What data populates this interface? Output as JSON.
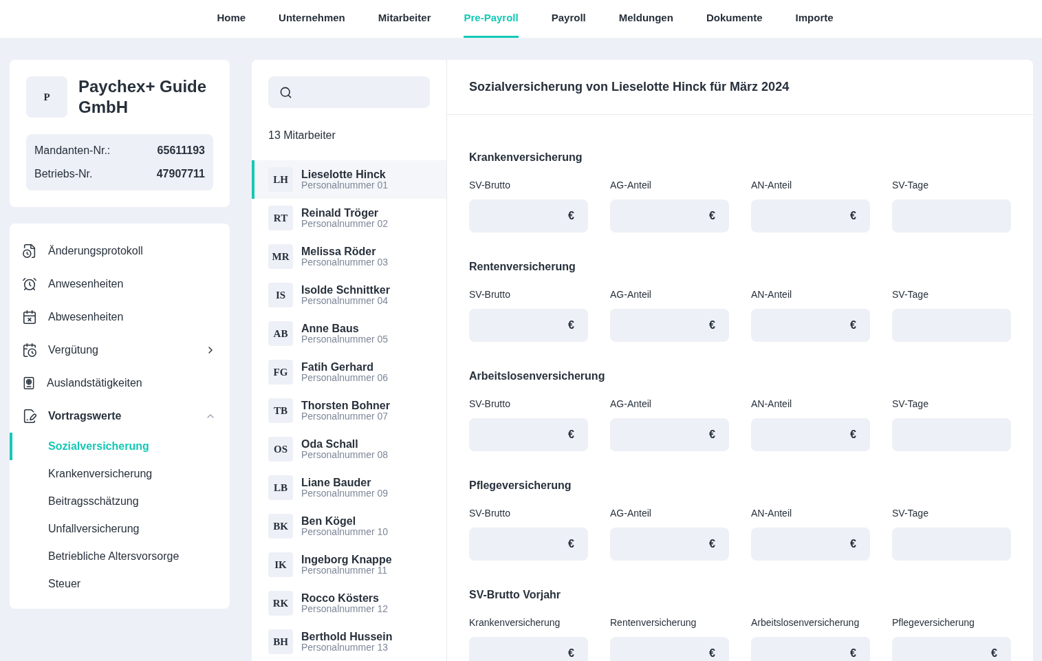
{
  "nav": [
    {
      "label": "Home",
      "selected": false
    },
    {
      "label": "Unternehmen",
      "selected": false
    },
    {
      "label": "Mitarbeiter",
      "selected": false
    },
    {
      "label": "Pre-Payroll",
      "selected": true
    },
    {
      "label": "Payroll",
      "selected": false
    },
    {
      "label": "Meldungen",
      "selected": false
    },
    {
      "label": "Dokumente",
      "selected": false
    },
    {
      "label": "Importe",
      "selected": false
    }
  ],
  "company": {
    "initial": "P",
    "name": "Paychex+ Guide GmbH",
    "facts": [
      {
        "label": "Mandanten-Nr.:",
        "value": "65611193"
      },
      {
        "label": "Betriebs-Nr.",
        "value": "47907711"
      }
    ]
  },
  "sidebar": {
    "items": [
      {
        "kind": "link",
        "label": "Änderungsprotokoll"
      },
      {
        "kind": "link",
        "label": "Anwesenheiten"
      },
      {
        "kind": "link",
        "label": "Abwesenheiten"
      },
      {
        "kind": "group",
        "label": "Vergütung",
        "expanded": false
      },
      {
        "kind": "link",
        "label": "Auslandstätigkeiten"
      },
      {
        "kind": "group",
        "label": "Vortragswerte",
        "expanded": true,
        "children": [
          {
            "label": "Sozialversicherung",
            "selected": true
          },
          {
            "label": "Krankenversicherung",
            "selected": false
          },
          {
            "label": "Beitragsschätzung",
            "selected": false
          },
          {
            "label": "Unfallversicherung",
            "selected": false
          },
          {
            "label": "Betriebliche Altersvorsorge",
            "selected": false
          },
          {
            "label": "Steuer",
            "selected": false
          }
        ]
      }
    ]
  },
  "employees": {
    "count": "13 Mitarbeiter",
    "rows": [
      {
        "initials": "LH",
        "name": "Lieselotte Hinck",
        "number": "Personalnummer 01",
        "selected": true
      },
      {
        "initials": "RT",
        "name": "Reinald Tröger",
        "number": "Personalnummer 02",
        "selected": false
      },
      {
        "initials": "MR",
        "name": "Melissa Röder",
        "number": "Personalnummer 03",
        "selected": false
      },
      {
        "initials": "IS",
        "name": "Isolde Schnittker",
        "number": "Personalnummer 04",
        "selected": false
      },
      {
        "initials": "AB",
        "name": "Anne Baus",
        "number": "Personalnummer 05",
        "selected": false
      },
      {
        "initials": "FG",
        "name": "Fatih Gerhard",
        "number": "Personalnummer 06",
        "selected": false
      },
      {
        "initials": "TB",
        "name": "Thorsten Bohner",
        "number": "Personalnummer 07",
        "selected": false
      },
      {
        "initials": "OS",
        "name": "Oda Schall",
        "number": "Personalnummer 08",
        "selected": false
      },
      {
        "initials": "LB",
        "name": "Liane Bauder",
        "number": "Personalnummer 09",
        "selected": false
      },
      {
        "initials": "BK",
        "name": "Ben Kögel",
        "number": "Personalnummer 10",
        "selected": false
      },
      {
        "initials": "IK",
        "name": "Ingeborg Knappe",
        "number": "Personalnummer 11",
        "selected": false
      },
      {
        "initials": "RK",
        "name": "Rocco Kösters",
        "number": "Personalnummer 12",
        "selected": false
      },
      {
        "initials": "BH",
        "name": "Berthold Hussein",
        "number": "Personalnummer 13",
        "selected": false
      }
    ]
  },
  "detail": {
    "title": "Sozialversicherung von Lieselotte Hinck für März 2024",
    "sections": [
      {
        "title": "Krankenversicherung",
        "fields": [
          {
            "label": "SV-Brutto",
            "unit": "€"
          },
          {
            "label": "AG-Anteil",
            "unit": "€"
          },
          {
            "label": "AN-Anteil",
            "unit": "€"
          },
          {
            "label": "SV-Tage"
          }
        ]
      },
      {
        "title": "Rentenversicherung",
        "fields": [
          {
            "label": "SV-Brutto",
            "unit": "€"
          },
          {
            "label": "AG-Anteil",
            "unit": "€"
          },
          {
            "label": "AN-Anteil",
            "unit": "€"
          },
          {
            "label": "SV-Tage"
          }
        ]
      },
      {
        "title": "Arbeitslosenversicherung",
        "fields": [
          {
            "label": "SV-Brutto",
            "unit": "€"
          },
          {
            "label": "AG-Anteil",
            "unit": "€"
          },
          {
            "label": "AN-Anteil",
            "unit": "€"
          },
          {
            "label": "SV-Tage"
          }
        ]
      },
      {
        "title": "Pflegeversicherung",
        "fields": [
          {
            "label": "SV-Brutto",
            "unit": "€"
          },
          {
            "label": "AG-Anteil",
            "unit": "€"
          },
          {
            "label": "AN-Anteil",
            "unit": "€"
          },
          {
            "label": "SV-Tage"
          }
        ]
      },
      {
        "title": "SV-Brutto Vorjahr",
        "fields": [
          {
            "label": "Krankenversicherung",
            "unit": "€"
          },
          {
            "label": "Rentenversicherung",
            "unit": "€"
          },
          {
            "label": "Arbeitslosenversicherung",
            "unit": "€"
          },
          {
            "label": "Pflegeversicherung",
            "unit": "€"
          }
        ]
      }
    ]
  }
}
